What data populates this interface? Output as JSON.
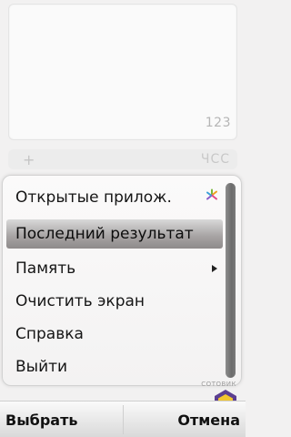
{
  "calculator": {
    "display_value": "123",
    "background_row_tail": "ЧСС"
  },
  "menu": {
    "items": [
      {
        "label": "Открытые прилож.",
        "icon": "multitask-icon",
        "highlighted": false
      },
      {
        "label": "Последний результат",
        "highlighted": true
      },
      {
        "label": "Память",
        "icon": "submenu-arrow-icon",
        "highlighted": false
      },
      {
        "label": "Очистить экран",
        "highlighted": false
      },
      {
        "label": "Справка",
        "highlighted": false
      },
      {
        "label": "Выйти",
        "highlighted": false
      }
    ]
  },
  "watermark": {
    "text": "СОТОВИК"
  },
  "softkeys": {
    "left": "Выбрать",
    "right": "Отмена"
  },
  "colors": {
    "highlight": "#a9a6a6",
    "background": "#f2f1f1",
    "watermark_yellow": "#f2c62e",
    "watermark_purple": "#5c3f91"
  }
}
